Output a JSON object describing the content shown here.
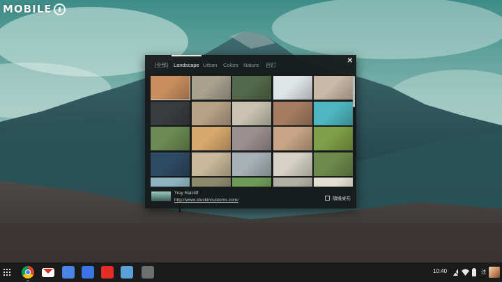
{
  "watermark": {
    "text": "MOBILE"
  },
  "picker": {
    "tabs": [
      {
        "label": "[全部]",
        "active": false
      },
      {
        "label": "Landscape",
        "active": true
      },
      {
        "label": "Urban",
        "active": false
      },
      {
        "label": "Colors",
        "active": false
      },
      {
        "label": "Nature",
        "active": false
      },
      {
        "label": "自訂",
        "active": false
      }
    ],
    "close_icon": "close-icon",
    "thumbnails": [
      [
        "#c98e5e",
        "#a8a28e",
        "#536a4a",
        "#dfe4e6",
        "#c9b9a6"
      ],
      [
        "#3a3d3f",
        "#b8a187",
        "#c9c2b0",
        "#a57d62",
        "#4fb7c1"
      ],
      [
        "#6a8a52",
        "#d8a86c",
        "#9b8f90",
        "#c7a586",
        "#7f9f48"
      ],
      [
        "#2f4a63",
        "#c9b89b",
        "#a6b2b6",
        "#d6d2c8",
        "#6e8a4c"
      ],
      [
        "#8fb3c1",
        "#8b8a6c",
        "#6f9a57",
        "#b2b0a4",
        "#e2dfd0"
      ]
    ],
    "selected": "0,0",
    "credit": {
      "author": "Trey Ratcliff",
      "link": "http://www.stuckincustoms.com/"
    },
    "random_label": "隨機桌布",
    "random_checked": false
  },
  "shelf": {
    "launcher_icon": "app-launcher-icon",
    "apps": [
      {
        "name": "chrome-app-icon",
        "color": "#db4437"
      },
      {
        "name": "gmail-app-icon",
        "color": "#ffffff"
      },
      {
        "name": "google-search-app-icon",
        "color": "#4a86e8"
      },
      {
        "name": "docs-app-icon",
        "color": "#3b74e7"
      },
      {
        "name": "youtube-app-icon",
        "color": "#e52d27"
      },
      {
        "name": "files-app-icon",
        "color": "#5aa0d8"
      },
      {
        "name": "settings-app-icon",
        "color": "#6b6f70"
      }
    ]
  },
  "status": {
    "time": "10:40",
    "ime": "注",
    "icons": [
      "no-network-icon",
      "wifi-icon",
      "battery-icon"
    ]
  }
}
